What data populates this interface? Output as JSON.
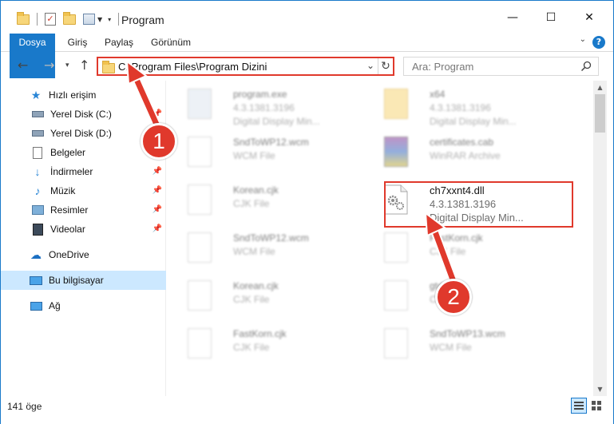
{
  "window": {
    "title": "Program",
    "minimize_label": "—",
    "maximize_label": "☐",
    "close_label": "✕"
  },
  "ribbon": {
    "tabs": [
      "Dosya",
      "Giriş",
      "Paylaş",
      "Görünüm"
    ],
    "help_label": "?"
  },
  "nav": {
    "address": "C:\\Program Files\\Program Dizini",
    "search_placeholder": "Ara: Program"
  },
  "sidebar": {
    "items": [
      {
        "label": "Hızlı erişim",
        "icon": "star-icon"
      },
      {
        "label": "Yerel Disk (C:)",
        "icon": "drive-icon",
        "pinned": true
      },
      {
        "label": "Yerel Disk (D:)",
        "icon": "drive-icon"
      },
      {
        "label": "Belgeler",
        "icon": "documents-icon",
        "pinned": true
      },
      {
        "label": "İndirmeler",
        "icon": "download-icon",
        "pinned": true
      },
      {
        "label": "Müzik",
        "icon": "music-icon",
        "pinned": true
      },
      {
        "label": "Resimler",
        "icon": "pictures-icon",
        "pinned": true
      },
      {
        "label": "Videolar",
        "icon": "videos-icon",
        "pinned": true
      },
      {
        "label": "OneDrive",
        "icon": "cloud-icon"
      },
      {
        "label": "Bu bilgisayar",
        "icon": "computer-icon",
        "selected": true
      },
      {
        "label": "Ağ",
        "icon": "network-icon"
      }
    ]
  },
  "files": {
    "left_col": [
      {
        "name": "program.exe",
        "line2": "4.3.1381.3196",
        "line3": "Digital Display Min..."
      },
      {
        "name": "SndToWP12.wcm",
        "line2": "WCM File",
        "line3": ""
      },
      {
        "name": "Korean.cjk",
        "line2": "CJK File",
        "line3": ""
      },
      {
        "name": "SndToWP12.wcm",
        "line2": "WCM File",
        "line3": ""
      },
      {
        "name": "Korean.cjk",
        "line2": "CJK File",
        "line3": ""
      },
      {
        "name": "FastKorn.cjk",
        "line2": "CJK File",
        "line3": ""
      }
    ],
    "right_col": [
      {
        "name": "x64",
        "line2": "4.3.1381.3196",
        "line3": "Digital Display Min..."
      },
      {
        "name": "certificates.cab",
        "line2": "WinRAR Archive",
        "line3": ""
      },
      {
        "name": "ch7xxnt4.dll",
        "line2": "4.3.1381.3196",
        "line3": "Digital Display Min..."
      },
      {
        "name": "FastKorn.cjk",
        "line2": "CJK File",
        "line3": ""
      },
      {
        "name": "gtdl",
        "line2": "CJK File",
        "line3": ""
      },
      {
        "name": "SndToWP13.wcm",
        "line2": "WCM File",
        "line3": ""
      }
    ]
  },
  "status": {
    "item_count": "141 öge"
  },
  "callouts": {
    "one": "1",
    "two": "2"
  },
  "colors": {
    "accent": "#1979ca",
    "highlight_red": "#e0392c",
    "selection": "#cce8ff"
  }
}
